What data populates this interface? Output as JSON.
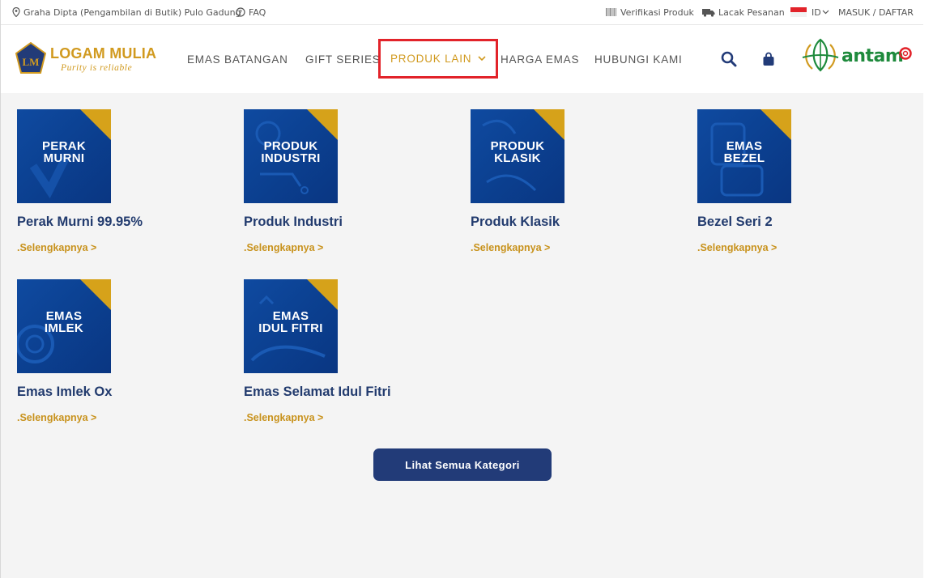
{
  "topbar": {
    "location": "Graha Dipta (Pengambilan di Butik) Pulo Gadung",
    "faq": "FAQ",
    "verify": "Verifikasi Produk",
    "track": "Lacak Pesanan",
    "lang": "ID",
    "login": "MASUK / DAFTAR"
  },
  "header": {
    "logo_title": "LOGAM MULIA",
    "logo_tagline": "Purity is reliable",
    "logo_monogram": "LM",
    "partner": "antam",
    "nav": [
      {
        "label": "EMAS BATANGAN"
      },
      {
        "label": "GIFT SERIES"
      },
      {
        "label": "PRODUK LAIN"
      },
      {
        "label": "HARGA EMAS"
      },
      {
        "label": "HUBUNGI KAMI"
      }
    ]
  },
  "products": [
    {
      "thumb_l1": "PERAK",
      "thumb_l2": "MURNI",
      "title": "Perak Murni 99.95%",
      "more": ".Selengkapnya >"
    },
    {
      "thumb_l1": "PRODUK",
      "thumb_l2": "INDUSTRI",
      "title": "Produk Industri",
      "more": ".Selengkapnya >"
    },
    {
      "thumb_l1": "PRODUK",
      "thumb_l2": "KLASIK",
      "title": "Produk Klasik",
      "more": ".Selengkapnya >"
    },
    {
      "thumb_l1": "EMAS",
      "thumb_l2": "BEZEL",
      "title": "Bezel Seri 2",
      "more": ".Selengkapnya >"
    },
    {
      "thumb_l1": "EMAS",
      "thumb_l2": "IMLEK",
      "title": "Emas Imlek Ox",
      "more": ".Selengkapnya >"
    },
    {
      "thumb_l1": "EMAS",
      "thumb_l2": "IDUL FITRI",
      "title": "Emas Selamat Idul Fitri",
      "more": ".Selengkapnya >"
    }
  ],
  "cta_label": "Lihat Semua Kategori",
  "colors": {
    "gold": "#d19a1f",
    "navy": "#223b78",
    "thumb_blue": "#0f4aa0",
    "highlight_red": "#e2232a",
    "antam_green": "#1e8a3c"
  },
  "icons": {
    "location": "map-pin-icon",
    "faq": "question-circle-icon",
    "verify": "barcode-icon",
    "track": "truck-icon",
    "lang": "indonesia-flag-icon",
    "search": "search-icon",
    "cart": "shopping-bag-icon"
  }
}
